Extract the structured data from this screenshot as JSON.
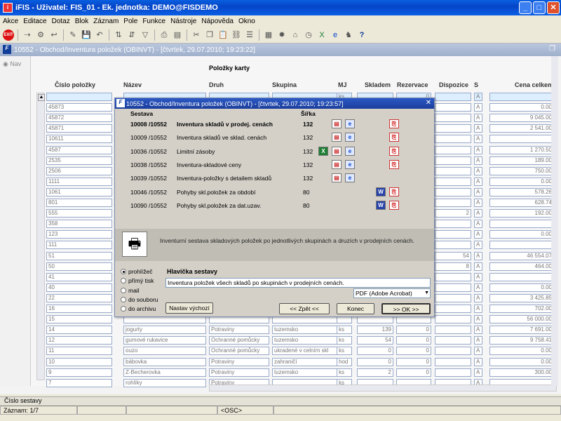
{
  "app": {
    "title": "iFIS - Uživatel: FIS_01 - Ek. jednotka: DEMO@FISDEMO",
    "menu": [
      "Akce",
      "Editace",
      "Dotaz",
      "Blok",
      "Záznam",
      "Pole",
      "Funkce",
      "Nástroje",
      "Nápověda",
      "Okno"
    ],
    "toolbar_icons": [
      "exit-icon",
      "separator",
      "disk-icon",
      "tool-icon",
      "arrow-icon",
      "separator",
      "insert-icon",
      "save-icon",
      "undo-icon",
      "separator",
      "sort-icon",
      "filter-icon",
      "separator",
      "print-icon",
      "preview-icon",
      "separator",
      "cut-icon",
      "copy-icon",
      "paste-icon",
      "link-icon",
      "separator",
      "report-icon",
      "fisheye-icon",
      "calc-icon",
      "clock-icon",
      "excel-icon",
      "ie-icon",
      "help-icon",
      "question-icon"
    ]
  },
  "mdi": {
    "title": "10552 - Obchod/Inventura položek (OBINVT) - [čtvrtek, 29.07.2010; 19:23:22]",
    "nav": "Nav",
    "section": "Položky karty",
    "headers": {
      "cislo": "Číslo položky",
      "nazev": "Název",
      "druh": "Druh",
      "skupina": "Skupina",
      "mj": "MJ",
      "skladem": "Skladem",
      "rezervace": "Rezervace",
      "dispozice": "Dispozice",
      "s": "S",
      "cena": "Cena celkem"
    },
    "rows": [
      {
        "cislo": "",
        "nazev": "",
        "druh": "",
        "skupina": "",
        "mj": "ks",
        "skladem": "",
        "rezervace": "0",
        "dispozice": "",
        "s": "A",
        "cena": ""
      },
      {
        "cislo": "45873",
        "nazev": "",
        "druh": "",
        "skupina": "",
        "mj": "",
        "skladem": "",
        "rezervace": "",
        "dispozice": "",
        "s": "A",
        "cena": "0.00"
      },
      {
        "cislo": "45872",
        "nazev": "",
        "druh": "",
        "skupina": "",
        "mj": "",
        "skladem": "",
        "rezervace": "",
        "dispozice": "",
        "s": "A",
        "cena": "9 045.00"
      },
      {
        "cislo": "45871",
        "nazev": "",
        "druh": "",
        "skupina": "",
        "mj": "",
        "skladem": "",
        "rezervace": "",
        "dispozice": "",
        "s": "A",
        "cena": "2 541.00"
      },
      {
        "cislo": "10611",
        "nazev": "",
        "druh": "",
        "skupina": "",
        "mj": "",
        "skladem": "",
        "rezervace": "",
        "dispozice": "",
        "s": "A",
        "cena": ""
      },
      {
        "cislo": "4587",
        "nazev": "",
        "druh": "",
        "skupina": "",
        "mj": "",
        "skladem": "",
        "rezervace": "",
        "dispozice": "",
        "s": "A",
        "cena": "1 270.50"
      },
      {
        "cislo": "2535",
        "nazev": "",
        "druh": "",
        "skupina": "",
        "mj": "",
        "skladem": "",
        "rezervace": "",
        "dispozice": "",
        "s": "A",
        "cena": "189.00"
      },
      {
        "cislo": "2506",
        "nazev": "",
        "druh": "",
        "skupina": "",
        "mj": "",
        "skladem": "",
        "rezervace": "",
        "dispozice": "",
        "s": "A",
        "cena": "750.00"
      },
      {
        "cislo": "1111",
        "nazev": "",
        "druh": "",
        "skupina": "",
        "mj": "",
        "skladem": "",
        "rezervace": "",
        "dispozice": "",
        "s": "A",
        "cena": "0.00"
      },
      {
        "cislo": "1061",
        "nazev": "",
        "druh": "",
        "skupina": "",
        "mj": "",
        "skladem": "",
        "rezervace": "",
        "dispozice": "",
        "s": "A",
        "cena": "578.26"
      },
      {
        "cislo": "801",
        "nazev": "",
        "druh": "",
        "skupina": "",
        "mj": "",
        "skladem": "",
        "rezervace": "",
        "dispozice": "",
        "s": "A",
        "cena": "628.74"
      },
      {
        "cislo": "555",
        "nazev": "",
        "druh": "",
        "skupina": "",
        "mj": "",
        "skladem": "",
        "rezervace": "",
        "dispozice": "2",
        "s": "A",
        "cena": "192.00"
      },
      {
        "cislo": "358",
        "nazev": "",
        "druh": "",
        "skupina": "",
        "mj": "",
        "skladem": "",
        "rezervace": "",
        "dispozice": "",
        "s": "A",
        "cena": ""
      },
      {
        "cislo": "123",
        "nazev": "",
        "druh": "",
        "skupina": "",
        "mj": "",
        "skladem": "",
        "rezervace": "",
        "dispozice": "",
        "s": "A",
        "cena": "0.00"
      },
      {
        "cislo": "111",
        "nazev": "",
        "druh": "",
        "skupina": "",
        "mj": "",
        "skladem": "",
        "rezervace": "",
        "dispozice": "",
        "s": "A",
        "cena": ""
      },
      {
        "cislo": "51",
        "nazev": "",
        "druh": "",
        "skupina": "",
        "mj": "",
        "skladem": "",
        "rezervace": "",
        "dispozice": "54",
        "s": "A",
        "cena": "46 554.07"
      },
      {
        "cislo": "50",
        "nazev": "",
        "druh": "",
        "skupina": "",
        "mj": "",
        "skladem": "",
        "rezervace": "",
        "dispozice": "8",
        "s": "A",
        "cena": "464.00"
      },
      {
        "cislo": "41",
        "nazev": "",
        "druh": "",
        "skupina": "",
        "mj": "",
        "skladem": "",
        "rezervace": "",
        "dispozice": "",
        "s": "A",
        "cena": ""
      },
      {
        "cislo": "40",
        "nazev": "",
        "druh": "",
        "skupina": "",
        "mj": "",
        "skladem": "",
        "rezervace": "",
        "dispozice": "",
        "s": "A",
        "cena": "0.00"
      },
      {
        "cislo": "22",
        "nazev": "",
        "druh": "",
        "skupina": "",
        "mj": "",
        "skladem": "",
        "rezervace": "",
        "dispozice": "",
        "s": "A",
        "cena": "3 425.85"
      },
      {
        "cislo": "16",
        "nazev": "",
        "druh": "",
        "skupina": "",
        "mj": "",
        "skladem": "",
        "rezervace": "",
        "dispozice": "",
        "s": "A",
        "cena": "702.00"
      },
      {
        "cislo": "15",
        "nazev": "",
        "druh": "",
        "skupina": "",
        "mj": "",
        "skladem": "",
        "rezervace": "",
        "dispozice": "",
        "s": "A",
        "cena": "56 000.00"
      },
      {
        "cislo": "14",
        "nazev": "jogurty",
        "druh": "Potraviny",
        "skupina": "tuzemsko",
        "mj": "ks",
        "skladem": "139",
        "rezervace": "0",
        "dispozice": "",
        "s": "A",
        "cena": "7 691.00"
      },
      {
        "cislo": "12",
        "nazev": "gumové rukavice",
        "druh": "Ochranné pomůcky",
        "skupina": "tuzemsko",
        "mj": "ks",
        "skladem": "54",
        "rezervace": "0",
        "dispozice": "",
        "s": "A",
        "cena": "9 758.41"
      },
      {
        "cislo": "11",
        "nazev": "ouzo",
        "druh": "Ochranné pomůcky",
        "skupina": "ukradené v celním skl",
        "mj": "ks",
        "skladem": "0",
        "rezervace": "0",
        "dispozice": "",
        "s": "A",
        "cena": "0.00"
      },
      {
        "cislo": "10",
        "nazev": "bábovka",
        "druh": "Potraviny",
        "skupina": "zahraničí",
        "mj": "hod",
        "skladem": "0",
        "rezervace": "0",
        "dispozice": "",
        "s": "A",
        "cena": "0.00"
      },
      {
        "cislo": "9",
        "nazev": "Z-Becherovka",
        "druh": "Potraviny",
        "skupina": "tuzemsko",
        "mj": "ks",
        "skladem": "2",
        "rezervace": "0",
        "dispozice": "",
        "s": "A",
        "cena": "300.00"
      },
      {
        "cislo": "7",
        "nazev": "rohlíky",
        "druh": "Potraviny",
        "skupina": "",
        "mj": "ks",
        "skladem": "",
        "rezervace": "",
        "dispozice": "",
        "s": "A",
        "cena": ""
      }
    ]
  },
  "dialog": {
    "title": "10552 - Obchod/Inventura položek (OBINVT) - [čtvrtek, 29.07.2010; 19:23:57]",
    "col_sestava": "Sestava",
    "col_sirka": "Šířka",
    "reports": [
      {
        "code": "10008 /10552",
        "name": "Inventura skladů v prodej. cenách",
        "width": "132",
        "icons": [
          "doc",
          "ie",
          "pdf"
        ]
      },
      {
        "code": "10009 /10552",
        "name": "Inventura skladů ve sklad. cenách",
        "width": "132",
        "icons": [
          "doc",
          "ie",
          "pdf"
        ]
      },
      {
        "code": "10036 /10552",
        "name": "Limitní zásoby",
        "width": "132",
        "icons": [
          "xl",
          "doc",
          "ie",
          "pdf"
        ]
      },
      {
        "code": "10038 /10552",
        "name": "Inventura-skladové ceny",
        "width": "132",
        "icons": [
          "doc",
          "ie",
          "pdf"
        ]
      },
      {
        "code": "10039 /10552",
        "name": "Inventura-položky s detailem skladů",
        "width": "132",
        "icons": [
          "doc",
          "ie"
        ]
      },
      {
        "code": "10046 /10552",
        "name": "Pohyby skl.položek za období",
        "width": "80",
        "icons": [
          "wd",
          "pdf"
        ]
      },
      {
        "code": "10090 /10552",
        "name": "Pohyby skl.položek za dat.uzav.",
        "width": "80",
        "icons": [
          "wd",
          "pdf"
        ]
      }
    ],
    "description": "Inventurní sestava skladových položek po jednotlivých skupinách a druzích v prodejních cenách.",
    "output_options": [
      "prohlížeč",
      "přímý tisk",
      "mail",
      "do souboru",
      "do archivu"
    ],
    "selected_output": "prohlížeč",
    "header_label": "Hlavička sestavy",
    "header_value": "Inventura položek všech skladů po skupinách v prodejních cenách.",
    "format_value": "PDF (Adobe Acrobat)",
    "btn_default": "Nastav výchozí",
    "btn_back": "<< Zpět <<",
    "btn_end": "Konec",
    "btn_ok": ">> OK >>"
  },
  "status": {
    "line1": "Číslo sestavy",
    "record": "Záznam: 1/7",
    "osc": "<OSC>"
  }
}
